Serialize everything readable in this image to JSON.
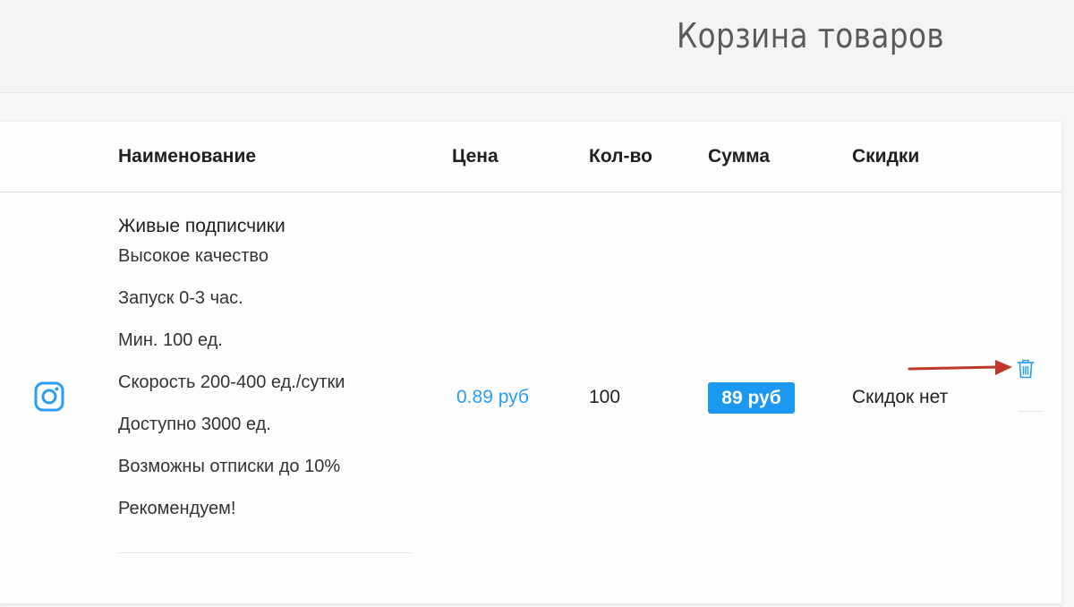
{
  "header": {
    "title": "Корзина товаров"
  },
  "table": {
    "columns": [
      "Наименование",
      "Цена",
      "Кол-во",
      "Сумма",
      "Скидки"
    ],
    "rows": [
      {
        "platform_icon": "instagram-icon",
        "name": "Живые подписчики",
        "features": [
          "Высокое качество",
          "Запуск 0-3 час.",
          "Мин. 100 ед.",
          "Скорость 200-400 ед./сутки",
          "Доступно 3000 ед.",
          "Возможны отписки до 10%",
          "Рекомендуем!"
        ],
        "price": "0.89 руб",
        "quantity": "100",
        "sum": "89 руб",
        "discount": "Скидок нет",
        "delete_icon": "trash-icon"
      }
    ]
  },
  "colors": {
    "accent": "#1b98f0",
    "price_text": "#2a9df4",
    "annotation_arrow": "#c0392b"
  }
}
